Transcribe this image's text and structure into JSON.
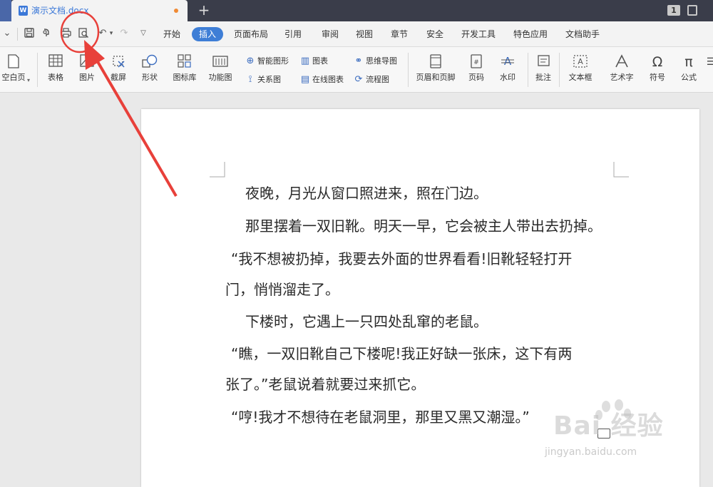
{
  "titlebar": {
    "doc_tab": "演示文档.docx",
    "wps_icon": "W",
    "new_tab": "+",
    "page_badge": "1"
  },
  "quickbar": {
    "icons": [
      "chevron-down-icon",
      "save-icon",
      "format-painter-icon",
      "print-icon",
      "print-preview-icon",
      "undo-icon",
      "redo-icon",
      "dropdown-icon"
    ]
  },
  "menu": {
    "items": [
      "开始",
      "插入",
      "页面布局",
      "引用",
      "审阅",
      "视图",
      "章节",
      "安全",
      "开发工具",
      "特色应用",
      "文档助手"
    ],
    "active": "插入"
  },
  "ribbon": {
    "blank_page": "空白页",
    "table": "表格",
    "picture": "图片",
    "screenshot": "截屏",
    "shape": "形状",
    "icon_lib": "图标库",
    "function_chart": "功能图",
    "smart_shape": "智能图形",
    "chart": "图表",
    "mind_map": "思维导图",
    "relation": "关系图",
    "online_chart": "在线图表",
    "flowchart": "流程图",
    "header_footer": "页眉和页脚",
    "page_num": "页码",
    "watermark": "水印",
    "comment": "批注",
    "textbox": "文本框",
    "art_text": "艺术字",
    "symbol": "符号",
    "formula": "公式"
  },
  "document": {
    "p1": "夜晚，月光从窗口照进来，照在门边。",
    "p2": "那里摆着一双旧靴。明天一早，它会被主人带出去扔掉。",
    "p3a": "“我不想被扔掉，我要去外面的世界看看!旧靴轻轻打开",
    "p3b": "门，悄悄溜走了。",
    "p4": "下楼时，它遇上一只四处乱窜的老鼠。",
    "p5a": "“瞧，一双旧靴自己下楼呢!我正好缺一张床，这下有两",
    "p5b": "张了。”老鼠说着就要过来抓它。",
    "p6": "“哼!我才不想待在老鼠洞里，那里又黑又潮湿。”"
  },
  "watermark": {
    "brand": "Bai 经验",
    "url": "jingyan.baidu.com"
  },
  "colors": {
    "accent": "#3e7ed6",
    "annotation": "#e8403a"
  }
}
